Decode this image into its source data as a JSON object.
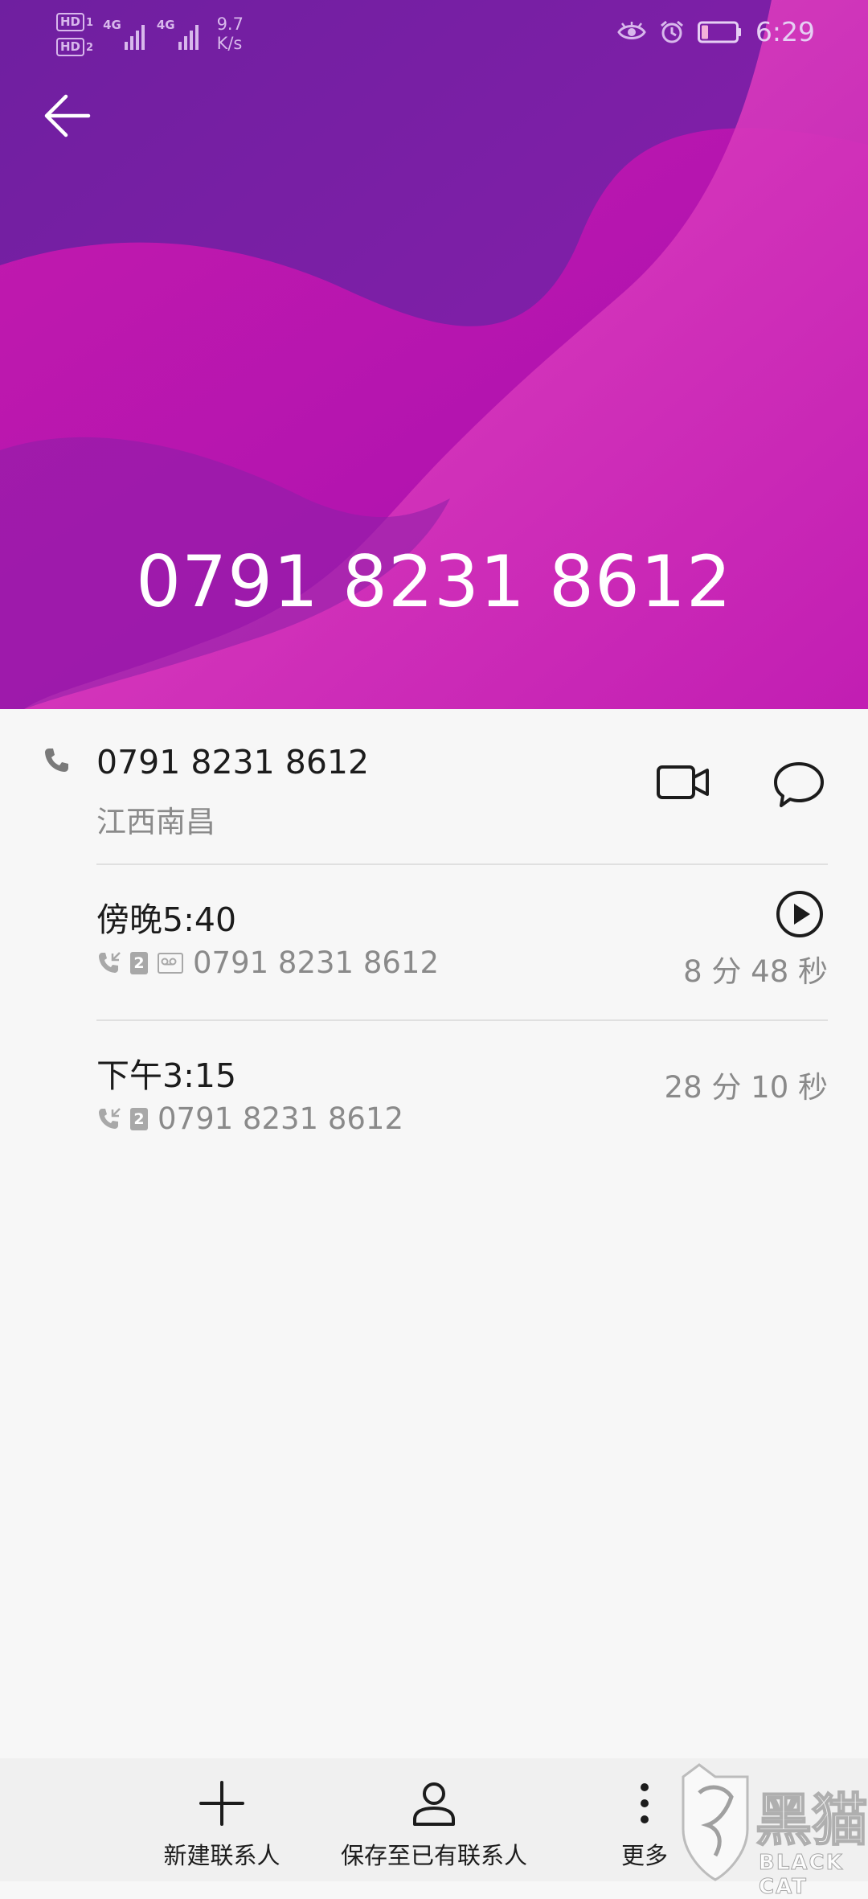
{
  "status_bar": {
    "hd1": "HD",
    "hd1_sub": "1",
    "hd2": "HD",
    "hd2_sub": "2",
    "net1": "4G",
    "net2": "4G",
    "speed_value": "9.7",
    "speed_unit": "K/s",
    "time": "6:29"
  },
  "header": {
    "phone_number": "0791 8231 8612",
    "colors": {
      "base": "#7b1fa6",
      "wave_magenta": "#b412ac",
      "wave_pink": "#dd3bb9"
    }
  },
  "contact": {
    "number": "0791 8231 8612",
    "location": "江西南昌"
  },
  "calls": [
    {
      "time": "傍晚5:40",
      "sim": "2",
      "number": "0791 8231 8612",
      "duration": "8 分 48 秒",
      "has_recording": true
    },
    {
      "time": "下午3:15",
      "sim": "2",
      "number": "0791 8231 8612",
      "duration": "28 分 10 秒",
      "has_recording": false
    }
  ],
  "bottom_bar": {
    "new_contact": "新建联系人",
    "save_existing": "保存至已有联系人",
    "more": "更多"
  },
  "watermark": {
    "text_cn": "黑猫",
    "text_en": "BLACK CAT"
  }
}
